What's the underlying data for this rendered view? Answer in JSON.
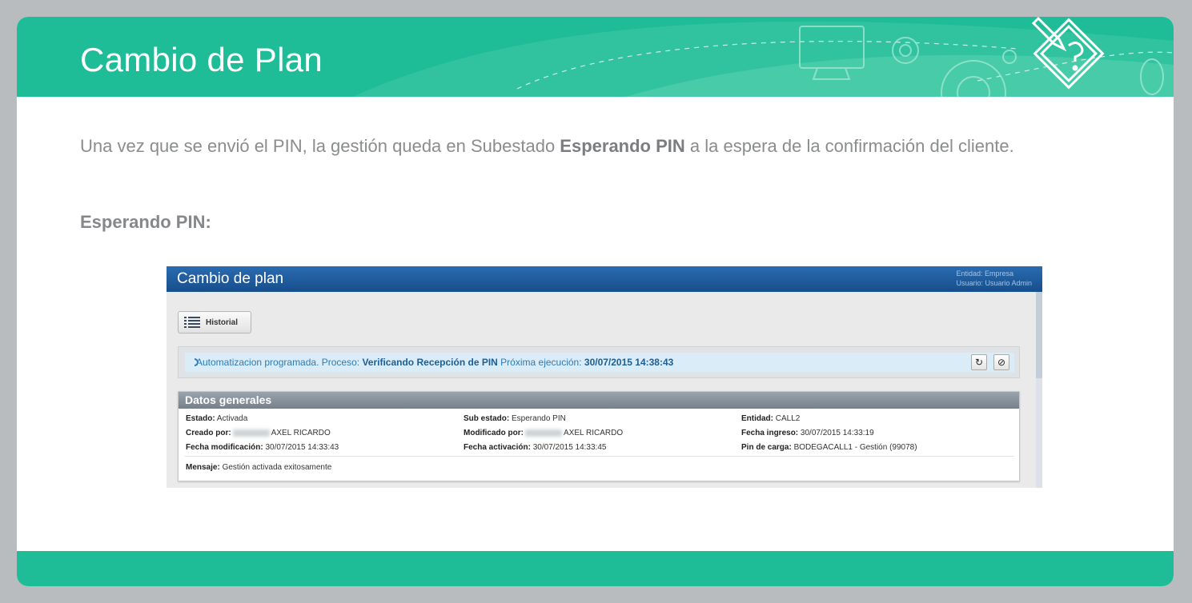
{
  "slide": {
    "title": "Cambio de Plan",
    "intro_pre": "Una vez que se envió el PIN, la gestión queda en Subestado ",
    "intro_bold": "Esperando PIN",
    "intro_post": " a la espera de la confirmación del cliente.",
    "subheading": "Esperando PIN:",
    "colors": {
      "accent": "#1fbd97",
      "text": "#8a8c8e"
    }
  },
  "app": {
    "title": "Cambio de plan",
    "entity_label": "Entidad: Empresa",
    "user_label": "Usuario: Usuario Admin",
    "historial_button": "Historial",
    "automation": {
      "prefix": "Automatizacion programada. Proceso: ",
      "process": "Verificando Recepción de PIN",
      "next_label": " Próxima ejecución: ",
      "next_time": "30/07/2015 14:38:43",
      "refresh_icon": "refresh-icon",
      "cancel_icon": "ban-icon"
    },
    "datos": {
      "header": "Datos generales",
      "estado_label": "Estado:",
      "estado_value": " Activada",
      "sub_estado_label": "Sub estado:",
      "sub_estado_value": " Esperando PIN",
      "entidad_label": "Entidad:",
      "entidad_value": " CALL2",
      "creado_label": "Creado por:",
      "creado_value": "AXEL RICARDO",
      "modificado_label": "Modificado por:",
      "modificado_value": "AXEL RICARDO",
      "fecha_ingreso_label": "Fecha ingreso:",
      "fecha_ingreso_value": " 30/07/2015 14:33:19",
      "fecha_mod_label": "Fecha modificación:",
      "fecha_mod_value": " 30/07/2015 14:33:43",
      "fecha_act_label": "Fecha activación:",
      "fecha_act_value": " 30/07/2015 14:33:45",
      "pin_label": "Pin de carga:",
      "pin_value": " BODEGACALL1 - Gestión (99078)",
      "mensaje_label": "Mensaje:",
      "mensaje_value": " Gestión activada exitosamente"
    }
  }
}
